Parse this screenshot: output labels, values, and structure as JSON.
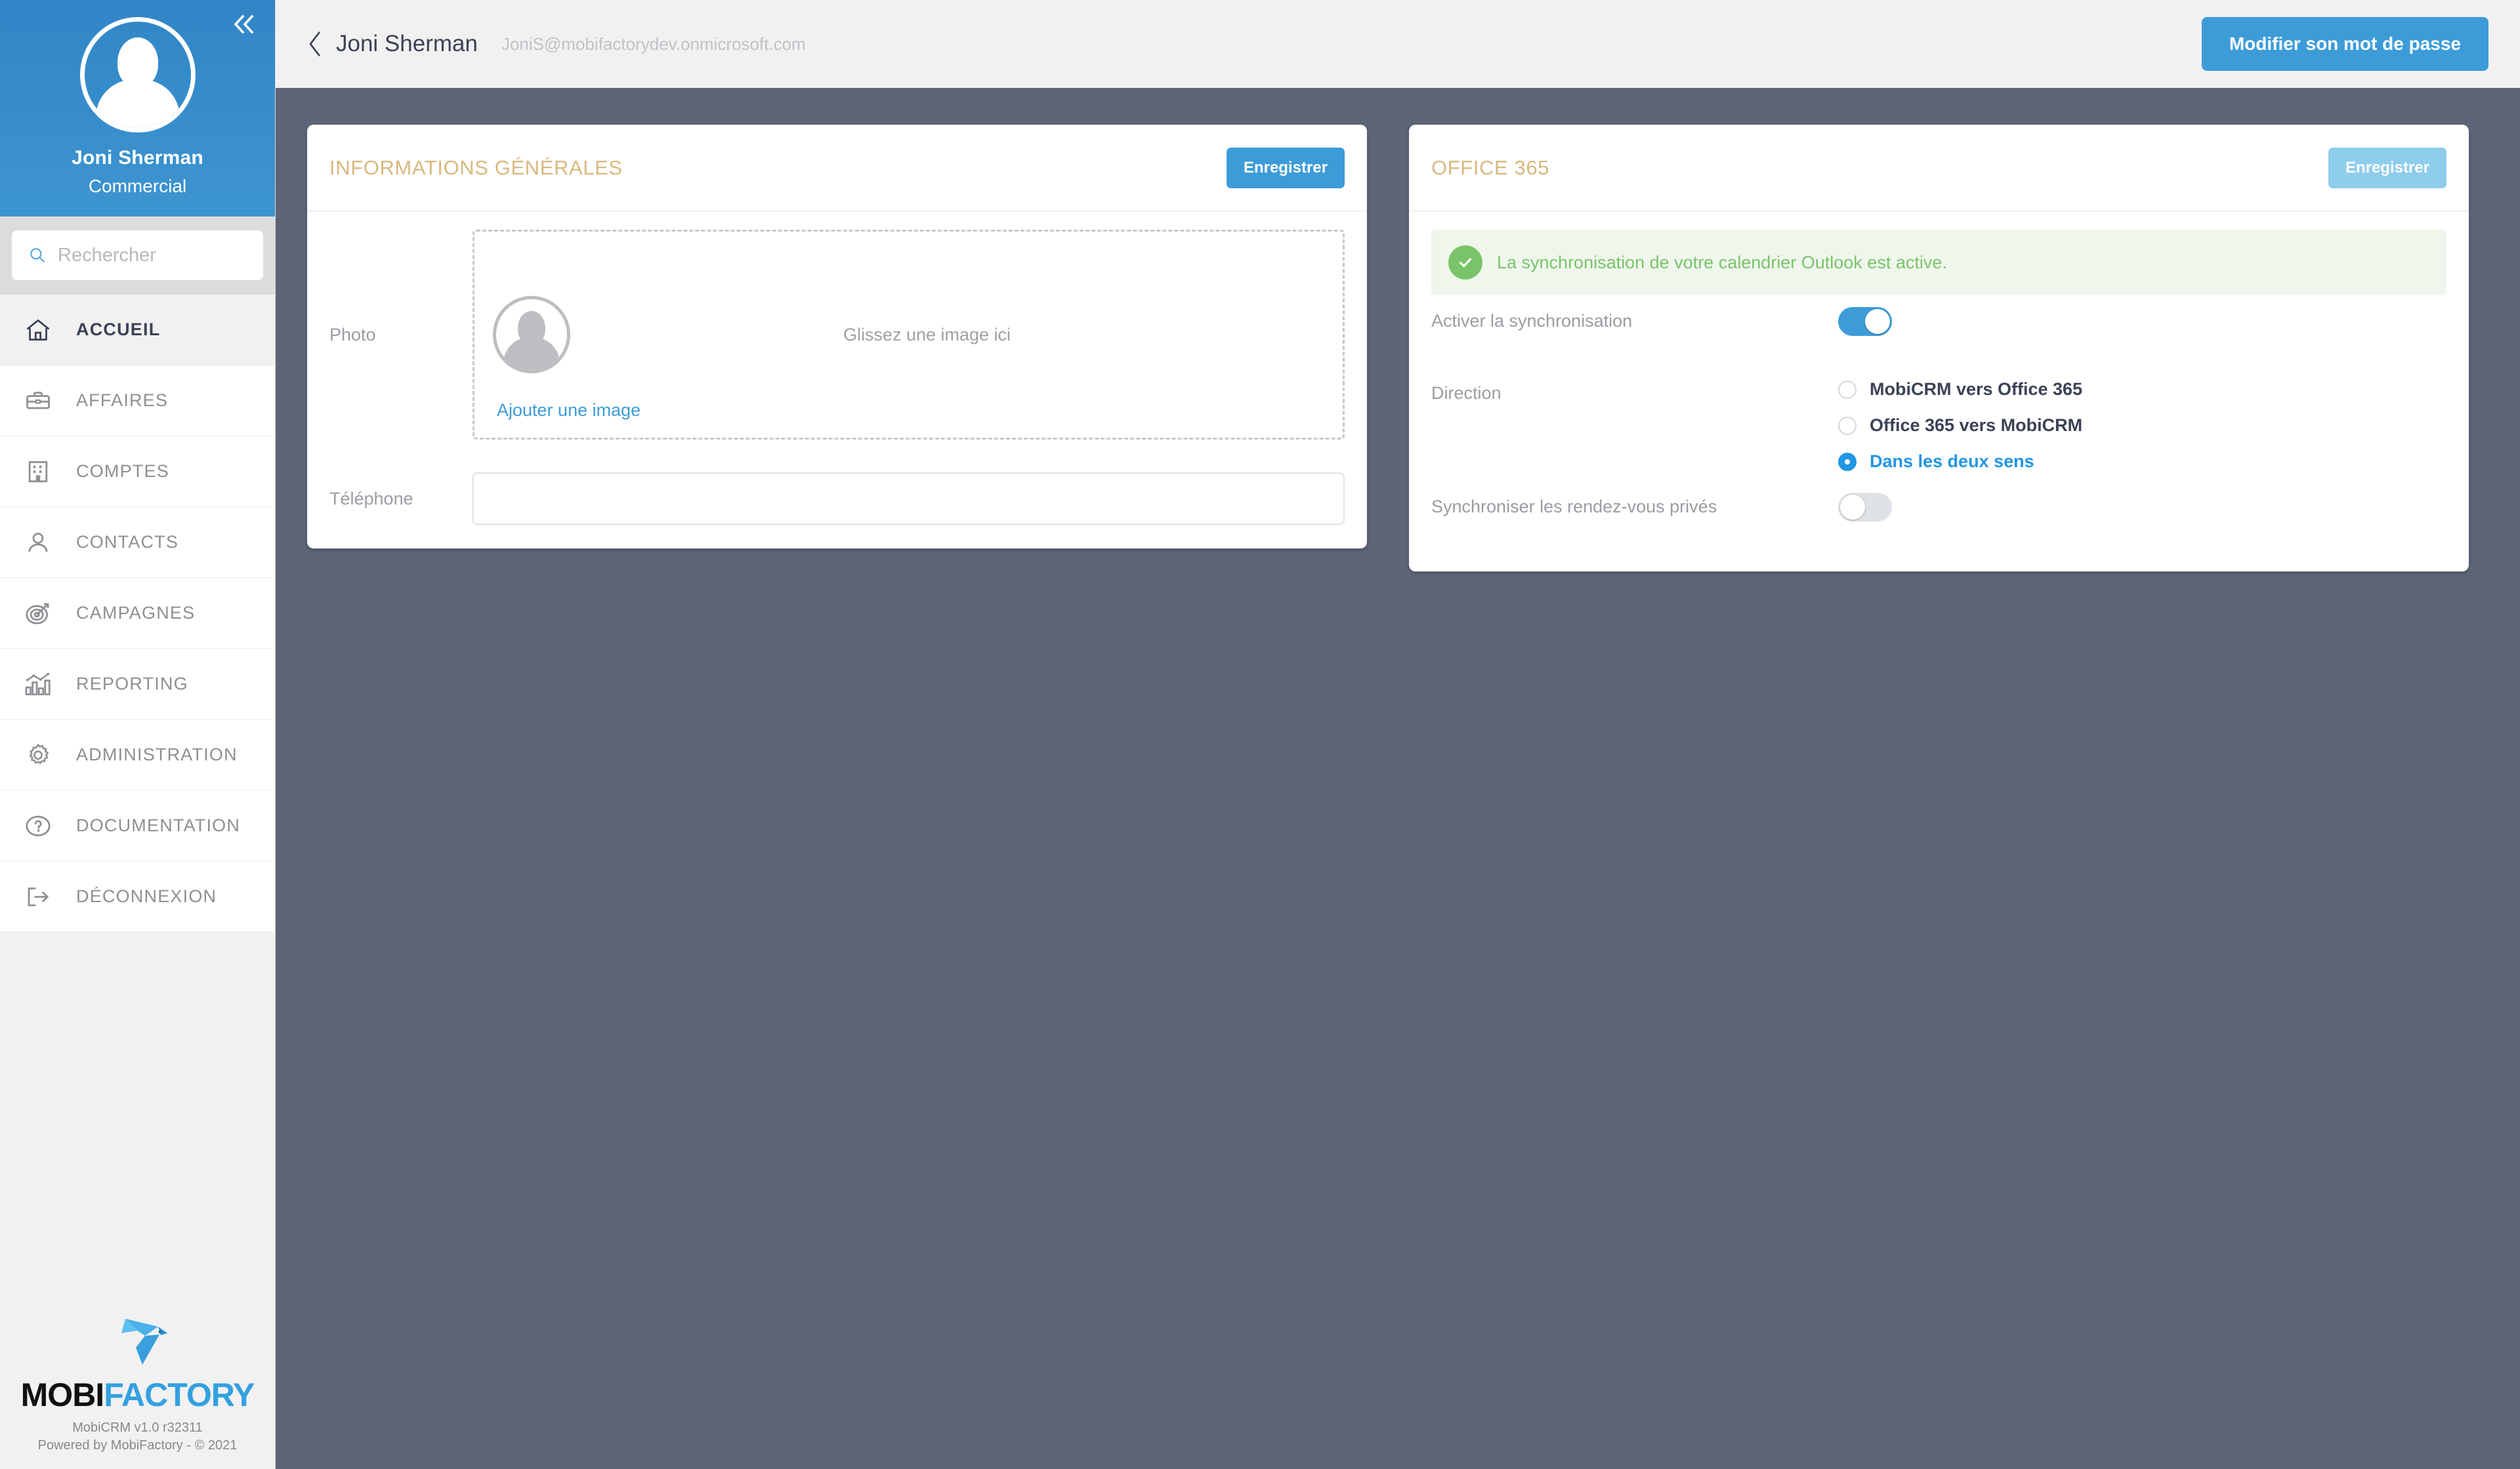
{
  "sidebar": {
    "collapse_icon": "chevrons-left-icon",
    "avatar_icon": "user-avatar-icon",
    "user_name": "Joni Sherman",
    "user_role": "Commercial",
    "search": {
      "placeholder": "Rechercher",
      "value": "",
      "icon": "search-icon"
    },
    "items": [
      {
        "label": "ACCUEIL",
        "icon": "home-icon",
        "active": true
      },
      {
        "label": "AFFAIRES",
        "icon": "briefcase-icon",
        "active": false
      },
      {
        "label": "COMPTES",
        "icon": "building-icon",
        "active": false
      },
      {
        "label": "CONTACTS",
        "icon": "person-icon",
        "active": false
      },
      {
        "label": "CAMPAGNES",
        "icon": "target-arrow-icon",
        "active": false
      },
      {
        "label": "REPORTING",
        "icon": "bar-chart-icon",
        "active": false
      },
      {
        "label": "ADMINISTRATION",
        "icon": "gear-icon",
        "active": false
      },
      {
        "label": "DOCUMENTATION",
        "icon": "question-mark-icon",
        "active": false
      },
      {
        "label": "DÉCONNEXION",
        "icon": "logout-icon",
        "active": false
      }
    ],
    "footer": {
      "logo_icon": "mobifactory-bird-icon",
      "logo_text_dark": "MOBI",
      "logo_text_blue": "FACTORY",
      "version_line1": "MobiCRM v1.0 r32311",
      "version_line2": "Powered by MobiFactory - © 2021"
    }
  },
  "topbar": {
    "back_icon": "chevron-left-icon",
    "title": "Joni Sherman",
    "email": "JoniS@mobifactorydev.onmicrosoft.com",
    "password_button": "Modifier son mot de passe"
  },
  "general_card": {
    "title": "INFORMATIONS GÉNÉRALES",
    "save_label": "Enregistrer",
    "photo_label": "Photo",
    "photo_icon": "user-avatar-placeholder-icon",
    "drop_hint": "Glissez une image ici",
    "add_image_link": "Ajouter une image",
    "phone_label": "Téléphone",
    "phone_value": "",
    "phone_placeholder": ""
  },
  "office_card": {
    "title": "OFFICE 365",
    "save_label": "Enregistrer",
    "save_disabled": true,
    "alert": {
      "icon": "check-circle-icon",
      "message": "La synchronisation de votre calendrier Outlook est active."
    },
    "sync_label": "Activer la synchronisation",
    "sync_enabled": true,
    "direction_label": "Direction",
    "direction_options": [
      {
        "label": "MobiCRM vers Office 365",
        "selected": false
      },
      {
        "label": "Office 365 vers MobiCRM",
        "selected": false
      },
      {
        "label": "Dans les deux sens",
        "selected": true
      }
    ],
    "private_label": "Synchroniser les rendez-vous privés",
    "private_enabled": false
  },
  "colors": {
    "sidebar_blue": "#3185c6",
    "accent_blue": "#3d9cd8",
    "accent_blue_disabled": "#8fcdec",
    "radio_blue": "#2196e3",
    "card_title_gold": "#d8b97e",
    "success_green": "#7ac36a",
    "success_bg": "#eff7ec",
    "content_bg": "#5d6476",
    "topbar_bg": "#f1f1f1",
    "search_band": "#dcdcdc"
  }
}
